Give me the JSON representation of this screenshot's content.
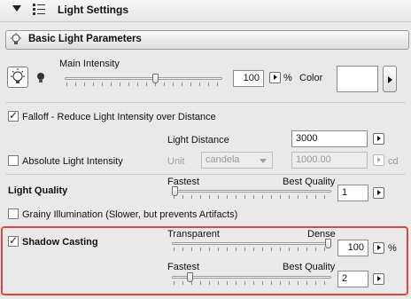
{
  "header": {
    "title": "Light Settings",
    "expand_icon": "triangle-down-icon",
    "panel_icon": "settings-grid-icon"
  },
  "section": {
    "title": "Basic Light Parameters",
    "icon": "bulb-icon"
  },
  "main_intensity": {
    "label": "Main Intensity",
    "value": "100",
    "unit": "%",
    "level": 0.58
  },
  "color": {
    "label": "Color",
    "swatch": "#ffffff"
  },
  "falloff": {
    "label": "Falloff - Reduce Light Intensity over Distance",
    "checked": true
  },
  "light_distance": {
    "label": "Light Distance",
    "value": "3000"
  },
  "absolute_intensity": {
    "label": "Absolute Light Intensity",
    "checked": false,
    "unit_label": "Unit",
    "unit_value": "candela",
    "value": "1000.00",
    "unit_suffix": "cd"
  },
  "light_quality": {
    "label": "Light Quality",
    "min_label": "Fastest",
    "max_label": "Best Quality",
    "value": "1",
    "level": 0.0
  },
  "grainy": {
    "label": "Grainy Illumination (Slower, but prevents Artifacts)",
    "checked": false
  },
  "shadow_casting": {
    "label": "Shadow Casting",
    "checked": true,
    "density": {
      "min_label": "Transparent",
      "max_label": "Dense",
      "value": "100",
      "unit": "%",
      "level": 1.0
    },
    "quality": {
      "min_label": "Fastest",
      "max_label": "Best Quality",
      "value": "2",
      "level": 0.1
    }
  },
  "colors": {
    "highlight": "#e0473f"
  }
}
